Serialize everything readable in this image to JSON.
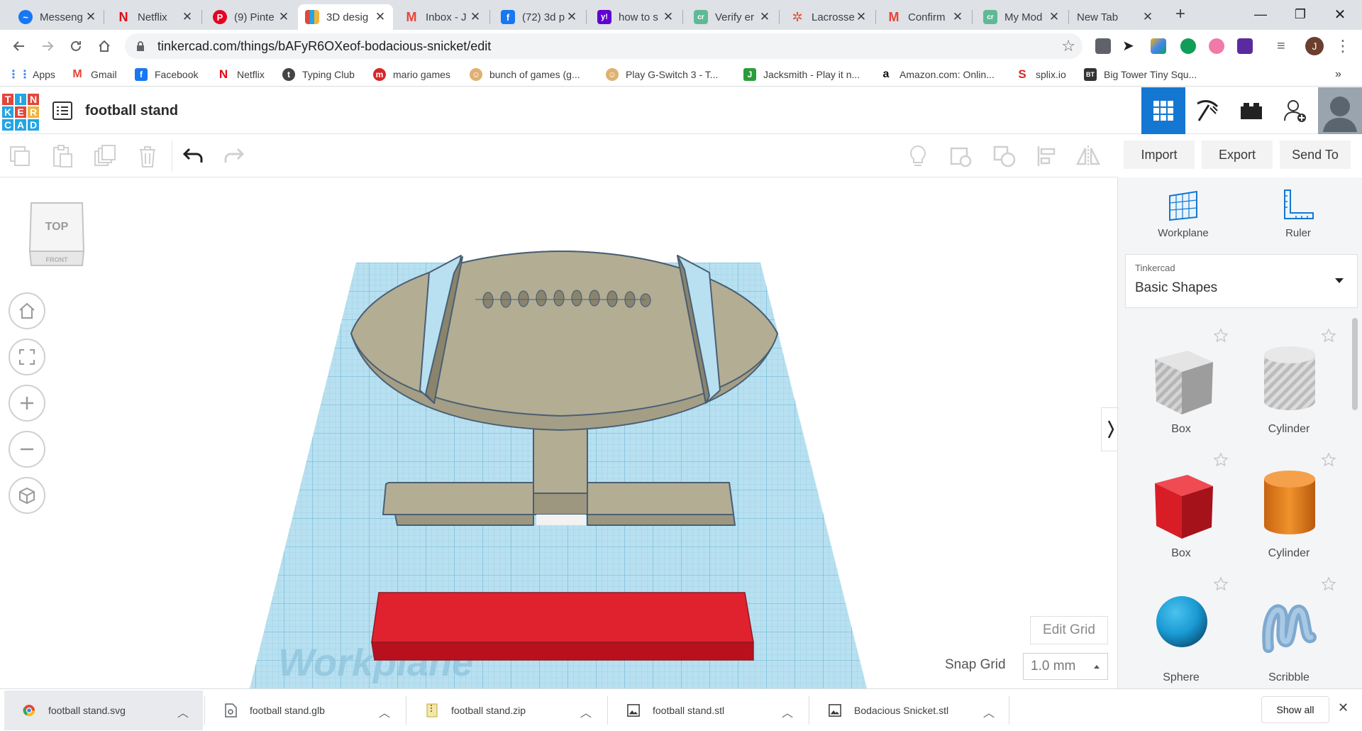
{
  "tabs": [
    {
      "title": "Messeng",
      "icon": "messenger-icon",
      "color": "#1877f2"
    },
    {
      "title": "Netflix",
      "icon": "netflix-icon",
      "color": "#e50914"
    },
    {
      "title": "(9) Pinte",
      "icon": "pinterest-icon",
      "color": "#e60023"
    },
    {
      "title": "3D desig",
      "icon": "tinkercad-icon",
      "color": "#1477d1",
      "active": true
    },
    {
      "title": "Inbox - J",
      "icon": "gmail-icon",
      "color": "#ea4335"
    },
    {
      "title": "(72) 3d p",
      "icon": "facebook-icon",
      "color": "#1877f2"
    },
    {
      "title": "how to s",
      "icon": "yahoo-icon",
      "color": "#6001d2"
    },
    {
      "title": "Verify er",
      "icon": "classroom-icon",
      "color": "#5fb996"
    },
    {
      "title": "Lacrosse",
      "icon": "pinwheel-icon",
      "color": "#e8532a"
    },
    {
      "title": "Confirm",
      "icon": "gmail-icon",
      "color": "#ea4335"
    },
    {
      "title": "My Mod",
      "icon": "classroom-icon",
      "color": "#5fb996"
    },
    {
      "title": "New Tab",
      "icon": "",
      "color": "#dee1e6"
    }
  ],
  "address": {
    "url": "tinkercad.com/things/bAFyR6OXeof-bodacious-snicket/edit"
  },
  "profile_initial": "J",
  "bookmarks": [
    {
      "label": "Apps",
      "icon": "apps-grid-icon",
      "color": "#4285f4"
    },
    {
      "label": "Gmail",
      "icon": "gmail-icon",
      "color": "#ea4335"
    },
    {
      "label": "Facebook",
      "icon": "facebook-icon",
      "color": "#1877f2"
    },
    {
      "label": "Netflix",
      "icon": "netflix-icon",
      "color": "#e50914"
    },
    {
      "label": "Typing Club",
      "icon": "typing-club-icon",
      "color": "#444444"
    },
    {
      "label": "mario games",
      "icon": "mario-icon",
      "color": "#d62828"
    },
    {
      "label": "bunch of games (g...",
      "icon": "games-icon",
      "color": "#e0b070"
    },
    {
      "label": "Play G-Switch 3 - T...",
      "icon": "games-icon",
      "color": "#e0b070"
    },
    {
      "label": "Jacksmith - Play it n...",
      "icon": "jacksmith-icon",
      "color": "#2a9d3a"
    },
    {
      "label": "Amazon.com: Onlin...",
      "icon": "amazon-icon",
      "color": "#111111"
    },
    {
      "label": "splix.io",
      "icon": "splix-icon",
      "color": "#d62828"
    },
    {
      "label": "Big Tower Tiny Squ...",
      "icon": "tower-icon",
      "color": "#333333"
    }
  ],
  "app": {
    "logo_letters": [
      "T",
      "I",
      "N",
      "K",
      "E",
      "R",
      "C",
      "A",
      "D"
    ],
    "logo_colors": [
      "#e2463b",
      "#22a5e4",
      "#e2463b",
      "#22a5e4",
      "#e2463b",
      "#f0b43c",
      "#22a5e4",
      "#22a5e4",
      "#22a5e4"
    ],
    "design_title": "football stand"
  },
  "toolbar": {
    "import": "Import",
    "export": "Export",
    "send_to": "Send To"
  },
  "viewcube": {
    "top": "TOP",
    "front": "FRONT"
  },
  "workplane_watermark": "Workplane",
  "grid": {
    "edit_grid": "Edit Grid",
    "snap_label": "Snap Grid",
    "snap_value": "1.0 mm"
  },
  "right_panel": {
    "workplane": "Workplane",
    "ruler": "Ruler",
    "library_label": "Tinkercad",
    "library_value": "Basic Shapes",
    "shapes": [
      "Box",
      "Cylinder",
      "Box",
      "Cylinder",
      "Sphere",
      "Scribble"
    ]
  },
  "downloads": [
    {
      "name": "football stand.svg",
      "icon": "chrome-icon"
    },
    {
      "name": "football stand.glb",
      "icon": "file-icon"
    },
    {
      "name": "football stand.zip",
      "icon": "zip-icon"
    },
    {
      "name": "football stand.stl",
      "icon": "image-file-icon"
    },
    {
      "name": "Bodacious Snicket.stl",
      "icon": "image-file-icon"
    }
  ],
  "show_all": "Show all",
  "colors": {
    "accent_blue": "#1477d1",
    "stand_body": "#b3ad94",
    "stand_outline": "#4a5f73",
    "red_block": "#e0222f",
    "grid_blue": "#a8d7ea",
    "sphere_blue": "#1a9bd4",
    "cylinder_orange": "#e8821e",
    "box_red": "#d81d26"
  }
}
